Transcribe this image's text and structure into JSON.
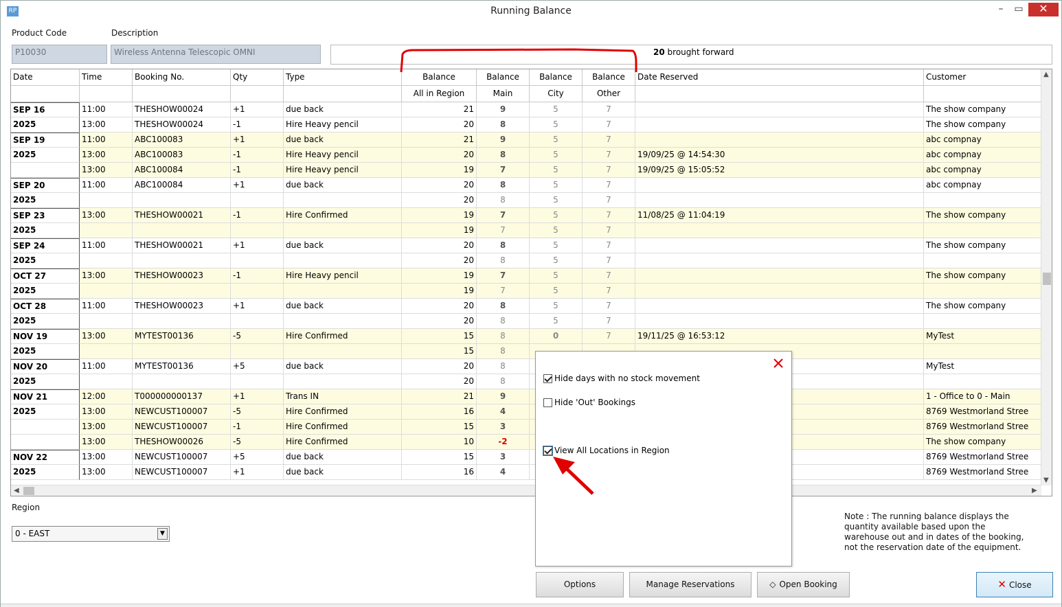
{
  "window": {
    "title": "Running Balance",
    "app_icon": "RP"
  },
  "product": {
    "code_label": "Product Code",
    "desc_label": "Description",
    "code": "P10030",
    "description": "Wireless Antenna Telescopic OMNI",
    "brought_forward_value": "20",
    "brought_forward_text": "brought forward"
  },
  "grid": {
    "header_top": [
      "Date",
      "Time",
      "Booking No.",
      "Qty",
      "Type",
      "Balance",
      "Balance",
      "Balance",
      "Balance",
      "Date Reserved",
      "Customer"
    ],
    "header_sub": [
      "",
      "",
      "",
      "",
      "",
      "All in Region",
      "Main",
      "City",
      "Other",
      "",
      ""
    ],
    "rows": [
      {
        "date": "SEP 16",
        "time": "11:00",
        "booking": "THESHOW00024",
        "qty": "+1",
        "type": "due back",
        "all": "21",
        "main": "9",
        "city": "5",
        "other": "7",
        "reserved": "",
        "customer": "The show company",
        "yellow": false,
        "first": true
      },
      {
        "date": "2025",
        "time": "13:00",
        "booking": "THESHOW00024",
        "qty": "-1",
        "type": "Hire Heavy pencil",
        "all": "20",
        "main": "8",
        "city": "5",
        "other": "7",
        "reserved": "",
        "customer": "The show company",
        "yellow": false,
        "first": false
      },
      {
        "date": "SEP 19",
        "time": "11:00",
        "booking": "ABC100083",
        "qty": "+1",
        "type": "due back",
        "all": "21",
        "main": "9",
        "city": "5",
        "other": "7",
        "reserved": "",
        "customer": "abc compnay",
        "yellow": true,
        "first": true
      },
      {
        "date": "2025",
        "time": "13:00",
        "booking": "ABC100083",
        "qty": "-1",
        "type": "Hire Heavy pencil",
        "all": "20",
        "main": "8",
        "city": "5",
        "other": "7",
        "reserved": "19/09/25 @ 14:54:30",
        "customer": "abc compnay",
        "yellow": true,
        "first": false
      },
      {
        "date": "",
        "time": "13:00",
        "booking": "ABC100084",
        "qty": "-1",
        "type": "Hire Heavy pencil",
        "all": "19",
        "main": "7",
        "city": "5",
        "other": "7",
        "reserved": "19/09/25 @ 15:05:52",
        "customer": "abc compnay",
        "yellow": true,
        "first": false
      },
      {
        "date": "SEP 20",
        "time": "11:00",
        "booking": "ABC100084",
        "qty": "+1",
        "type": "due back",
        "all": "20",
        "main": "8",
        "city": "5",
        "other": "7",
        "reserved": "",
        "customer": "abc compnay",
        "yellow": false,
        "first": true
      },
      {
        "date": "2025",
        "time": "",
        "booking": "",
        "qty": "",
        "type": "",
        "all": "20",
        "main": "8",
        "city": "5",
        "other": "7",
        "reserved": "",
        "customer": "",
        "yellow": false,
        "first": false,
        "weak": true
      },
      {
        "date": "SEP 23",
        "time": "13:00",
        "booking": "THESHOW00021",
        "qty": "-1",
        "type": "Hire Confirmed",
        "all": "19",
        "main": "7",
        "city": "5",
        "other": "7",
        "reserved": "11/08/25 @ 11:04:19",
        "customer": "The show company",
        "yellow": true,
        "first": true
      },
      {
        "date": "2025",
        "time": "",
        "booking": "",
        "qty": "",
        "type": "",
        "all": "19",
        "main": "7",
        "city": "5",
        "other": "7",
        "reserved": "",
        "customer": "",
        "yellow": true,
        "first": false,
        "weak": true
      },
      {
        "date": "SEP 24",
        "time": "11:00",
        "booking": "THESHOW00021",
        "qty": "+1",
        "type": "due back",
        "all": "20",
        "main": "8",
        "city": "5",
        "other": "7",
        "reserved": "",
        "customer": "The show company",
        "yellow": false,
        "first": true
      },
      {
        "date": "2025",
        "time": "",
        "booking": "",
        "qty": "",
        "type": "",
        "all": "20",
        "main": "8",
        "city": "5",
        "other": "7",
        "reserved": "",
        "customer": "",
        "yellow": false,
        "first": false,
        "weak": true
      },
      {
        "date": "OCT 27",
        "time": "13:00",
        "booking": "THESHOW00023",
        "qty": "-1",
        "type": "Hire Heavy pencil",
        "all": "19",
        "main": "7",
        "city": "5",
        "other": "7",
        "reserved": "",
        "customer": "The show company",
        "yellow": true,
        "first": true
      },
      {
        "date": "2025",
        "time": "",
        "booking": "",
        "qty": "",
        "type": "",
        "all": "19",
        "main": "7",
        "city": "5",
        "other": "7",
        "reserved": "",
        "customer": "",
        "yellow": true,
        "first": false,
        "weak": true
      },
      {
        "date": "OCT 28",
        "time": "11:00",
        "booking": "THESHOW00023",
        "qty": "+1",
        "type": "due back",
        "all": "20",
        "main": "8",
        "city": "5",
        "other": "7",
        "reserved": "",
        "customer": "The show company",
        "yellow": false,
        "first": true
      },
      {
        "date": "2025",
        "time": "",
        "booking": "",
        "qty": "",
        "type": "",
        "all": "20",
        "main": "8",
        "city": "5",
        "other": "7",
        "reserved": "",
        "customer": "",
        "yellow": false,
        "first": false,
        "weak": true
      },
      {
        "date": "NOV 19",
        "time": "13:00",
        "booking": "MYTEST00136",
        "qty": "-5",
        "type": "Hire Confirmed",
        "all": "15",
        "main": "8",
        "city": "0",
        "other": "7",
        "reserved": "19/11/25 @ 16:53:12",
        "customer": "MyTest",
        "yellow": true,
        "first": true,
        "weak": true,
        "city_bold": true
      },
      {
        "date": "2025",
        "time": "",
        "booking": "",
        "qty": "",
        "type": "",
        "all": "15",
        "main": "8",
        "city": "",
        "other": "",
        "reserved": "",
        "customer": "",
        "yellow": true,
        "first": false,
        "weak": true
      },
      {
        "date": "NOV 20",
        "time": "11:00",
        "booking": "MYTEST00136",
        "qty": "+5",
        "type": "due back",
        "all": "20",
        "main": "8",
        "city": "",
        "other": "",
        "reserved": "",
        "customer": "MyTest",
        "yellow": false,
        "first": true,
        "weak": true
      },
      {
        "date": "2025",
        "time": "",
        "booking": "",
        "qty": "",
        "type": "",
        "all": "20",
        "main": "8",
        "city": "",
        "other": "",
        "reserved": "",
        "customer": "",
        "yellow": false,
        "first": false,
        "weak": true
      },
      {
        "date": "NOV 21",
        "time": "12:00",
        "booking": "T000000000137",
        "qty": "+1",
        "type": "Trans IN",
        "all": "21",
        "main": "9",
        "city": "",
        "other": "",
        "reserved": "",
        "customer": "1 - Office to 0 - Main",
        "yellow": true,
        "first": true
      },
      {
        "date": "2025",
        "time": "13:00",
        "booking": "NEWCUST100007",
        "qty": "-5",
        "type": "Hire Confirmed",
        "all": "16",
        "main": "4",
        "city": "",
        "other": "",
        "reserved": "",
        "customer": "8769 Westmorland Stree",
        "yellow": true,
        "first": false
      },
      {
        "date": "",
        "time": "13:00",
        "booking": "NEWCUST100007",
        "qty": "-1",
        "type": "Hire Confirmed",
        "all": "15",
        "main": "3",
        "city": "",
        "other": "",
        "reserved": "",
        "customer": "8769 Westmorland Stree",
        "yellow": true,
        "first": false
      },
      {
        "date": "",
        "time": "13:00",
        "booking": "THESHOW00026",
        "qty": "-5",
        "type": "Hire Confirmed",
        "all": "10",
        "main": "-2",
        "city": "",
        "other": "",
        "reserved": "",
        "customer": "The show company",
        "yellow": true,
        "first": false,
        "neg": true
      },
      {
        "date": "NOV 22",
        "time": "13:00",
        "booking": "NEWCUST100007",
        "qty": "+5",
        "type": "due back",
        "all": "15",
        "main": "3",
        "city": "",
        "other": "",
        "reserved": "",
        "customer": "8769 Westmorland Stree",
        "yellow": false,
        "first": true
      },
      {
        "date": "2025",
        "time": "13:00",
        "booking": "NEWCUST100007",
        "qty": "+1",
        "type": "due back",
        "all": "16",
        "main": "4",
        "city": "",
        "other": "",
        "reserved": "",
        "customer": "8769 Westmorland Stree",
        "yellow": false,
        "first": false
      }
    ]
  },
  "region": {
    "label": "Region",
    "value": "0 - EAST"
  },
  "note": "Note : The running balance displays the quantity available based upon the warehouse out and in dates of the booking, not the reservation date of the equipment.",
  "popup": {
    "options": [
      {
        "label": "Hide days with no stock movement",
        "checked": true
      },
      {
        "label": "Hide 'Out' Bookings",
        "checked": false
      },
      {
        "label": "View All Locations in Region",
        "checked": true
      }
    ]
  },
  "buttons": {
    "options": "Options",
    "manage": "Manage Reservations",
    "open": "Open Booking",
    "close": "Close"
  },
  "colors": {
    "annotation": "#e00000",
    "row_highlight": "#fefce0",
    "negative": "#e00000"
  }
}
